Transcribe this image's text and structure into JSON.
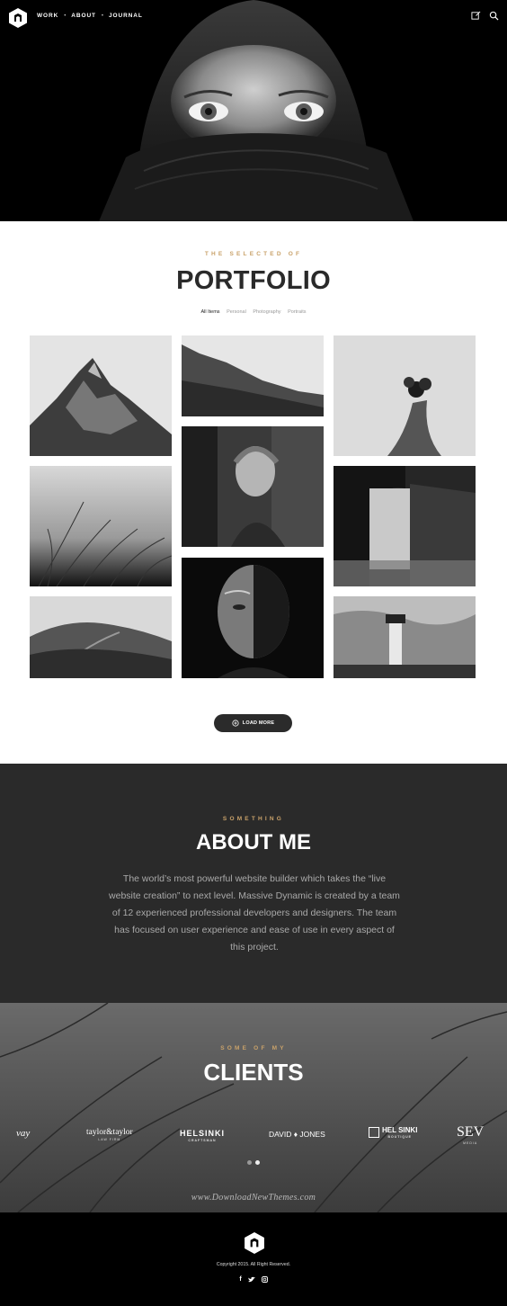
{
  "nav": {
    "items": [
      "WORK",
      "ABOUT",
      "JOURNAL"
    ],
    "icons": [
      "logo-icon",
      "edit-icon",
      "search-icon"
    ]
  },
  "portfolio": {
    "eyebrow": "THE SELECTED OF",
    "title": "PORTFOLIO",
    "filters": [
      "All Items",
      "Personal",
      "Photography",
      "Portraits"
    ],
    "active_filter": "All Items",
    "items": [
      "mountain-peak",
      "mountain-ridge",
      "hand-with-flowers",
      "grass-blades",
      "woman-portrait",
      "waterfall",
      "hills-path",
      "old-man-portrait",
      "lighthouse"
    ],
    "load_more": "LOAD MORE"
  },
  "about": {
    "eyebrow": "SOMETHING",
    "title": "ABOUT ME",
    "text": "The world’s most powerful website builder which takes the “live website creation” to next level. Massive Dynamic is created by a team of 12 experienced professional developers and designers. The team has focused on user experience and ease of use in every aspect of this project."
  },
  "clients": {
    "eyebrow": "SOME OF MY",
    "title": "CLIENTS",
    "logos": [
      {
        "name": "vay",
        "sub": ""
      },
      {
        "name": "taylor&taylor",
        "sub": "LAW FIRM"
      },
      {
        "name": "HELSINKI",
        "sub": "CRAFTSMAN"
      },
      {
        "name": "DAVID ♦ JONES",
        "sub": ""
      },
      {
        "name": "HEL SINKI",
        "sub": "BOUTIQUE"
      },
      {
        "name": "SEV",
        "sub": "MEDIA"
      }
    ],
    "slider_dots": 2,
    "watermark": "www.DownloadNewThemes.com"
  },
  "footer": {
    "copyright": "Copyright 2015. All Right Reserved.",
    "social": [
      "f",
      "t",
      "ig"
    ]
  }
}
